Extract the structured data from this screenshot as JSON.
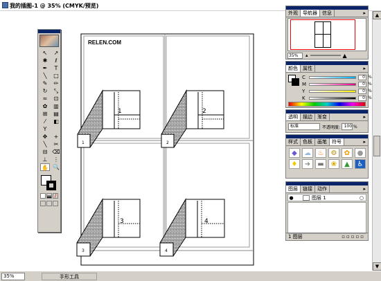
{
  "window": {
    "title": "我的插图-1 @ 35% (CMYK/预览)"
  },
  "status": {
    "zoom": "35%",
    "current_tool": "手形工具"
  },
  "document": {
    "watermark": "RELEN.COM",
    "page_labels": [
      "1",
      "2",
      "3",
      "4"
    ]
  },
  "navigator_panel": {
    "tabs": [
      "外观",
      "导航器",
      "信息"
    ],
    "active_tab": "导航器",
    "zoom": "35%"
  },
  "color_panel": {
    "tabs": [
      "颜色",
      "属性"
    ],
    "active_tab": "颜色",
    "channels": [
      {
        "name": "C",
        "value": "0",
        "unit": "%",
        "color": "#00aeef"
      },
      {
        "name": "M",
        "value": "0",
        "unit": "%",
        "color": "#ec008c"
      },
      {
        "name": "Y",
        "value": "0",
        "unit": "%",
        "color": "#fff200"
      },
      {
        "name": "K",
        "value": "0",
        "unit": "%",
        "color": "#000000"
      }
    ]
  },
  "transparency_panel": {
    "tabs": [
      "透明",
      "描边",
      "渐变"
    ],
    "blend_mode": "标准",
    "opacity_label": "不透明度:",
    "opacity_value": "100",
    "opacity_unit": "%"
  },
  "styles_panel": {
    "tabs": [
      "样式",
      "色板",
      "画笔",
      "符号"
    ],
    "active_tab": "符号",
    "symbols": [
      "fish-icon",
      "cloud-icon",
      "flame-icon",
      "gear-icon",
      "flower-icon",
      "blob-icon",
      "bulb-icon",
      "arrow-icon",
      "stamp-icon",
      "flower2-icon",
      "tree-icon",
      "wheelchair-icon"
    ]
  },
  "layers_panel": {
    "tabs": [
      "图层",
      "链接",
      "动作"
    ],
    "active_tab": "图层",
    "layers": [
      {
        "name": "图层 1"
      }
    ],
    "footer": "1 图层"
  }
}
